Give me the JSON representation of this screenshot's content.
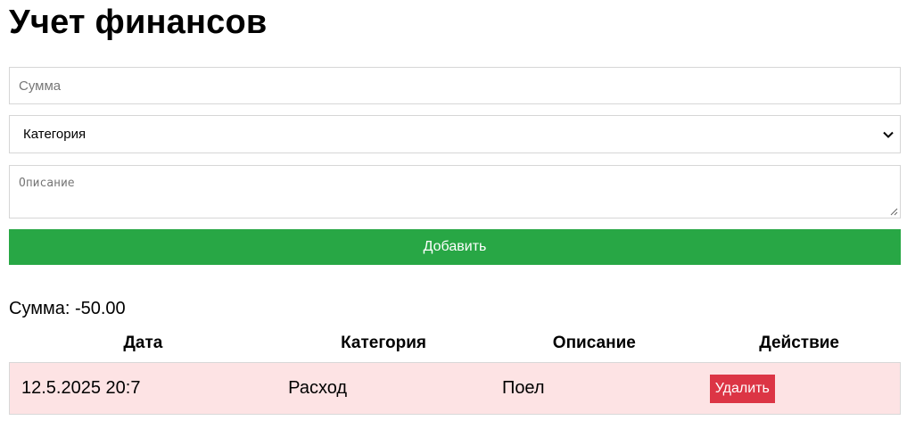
{
  "header": {
    "title": "Учет финансов"
  },
  "form": {
    "amount_placeholder": "Сумма",
    "category_selected": "Категория",
    "description_placeholder": "Описание",
    "add_label": "Добавить",
    "add_color": "#28a745"
  },
  "summary": {
    "label": "Сумма:",
    "value": "-50.00"
  },
  "table": {
    "columns": [
      "Дата",
      "Категория",
      "Описание",
      "Действие"
    ],
    "rows": [
      {
        "date": "12.5.2025 20:7",
        "category": "Расход",
        "description": "Поел",
        "action_label": "Удалить",
        "row_color": "#fde3e4",
        "action_color": "#dc3545"
      }
    ]
  }
}
